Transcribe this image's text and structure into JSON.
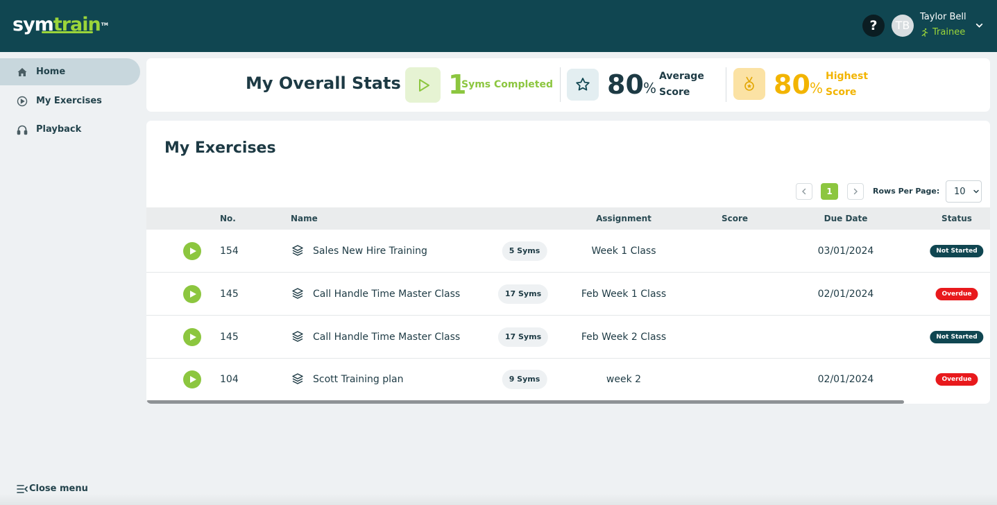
{
  "brand": {
    "logo_sym": "sym",
    "logo_train": "train",
    "logo_tm": "TM",
    "accent": "#8cc63f",
    "header_bg": "#104651"
  },
  "header": {
    "help_label": "?",
    "user_initials": "TB",
    "user_name": "Taylor Bell",
    "user_role": "Trainee"
  },
  "sidebar": {
    "items": [
      {
        "label": "Home",
        "icon": "home-icon",
        "active": true
      },
      {
        "label": "My Exercises",
        "icon": "play-circle-icon",
        "active": false
      },
      {
        "label": "Playback",
        "icon": "headphones-icon",
        "active": false
      }
    ],
    "close_menu": "Close menu"
  },
  "stats": {
    "title": "My Overall Stats",
    "completed": {
      "value": "1",
      "label": "Syms Completed",
      "icon": "play-outline-icon"
    },
    "average": {
      "value": "80",
      "unit": "%",
      "label_line1": "Average",
      "label_line2": "Score",
      "icon": "star-icon"
    },
    "highest": {
      "value": "80",
      "unit": "%",
      "label_line1": "Highest",
      "label_line2": "Score",
      "icon": "medal-icon"
    }
  },
  "exercises": {
    "title": "My Exercises",
    "pagination": {
      "current_page": "1",
      "rows_label": "Rows Per Page:",
      "rows_value": "10"
    },
    "columns": [
      "No.",
      "Name",
      "Assignment",
      "Score",
      "Due Date",
      "Status"
    ],
    "rows": [
      {
        "no": "154",
        "name": "Sales New Hire Training",
        "syms": "5 Syms",
        "assignment": "Week 1 Class",
        "score": "",
        "due_date": "03/01/2024",
        "status": "Not Started",
        "status_color": "#104651"
      },
      {
        "no": "145",
        "name": "Call Handle Time Master Class",
        "syms": "17 Syms",
        "assignment": "Feb Week 1 Class",
        "score": "",
        "due_date": "02/01/2024",
        "status": "Overdue",
        "status_color": "#e8191c"
      },
      {
        "no": "145",
        "name": "Call Handle Time Master Class",
        "syms": "17 Syms",
        "assignment": "Feb Week 2 Class",
        "score": "",
        "due_date": "",
        "status": "Not Started",
        "status_color": "#104651"
      },
      {
        "no": "104",
        "name": "Scott Training plan",
        "syms": "9 Syms",
        "assignment": "week 2",
        "score": "",
        "due_date": "02/01/2024",
        "status": "Overdue",
        "status_color": "#e8191c"
      }
    ]
  }
}
